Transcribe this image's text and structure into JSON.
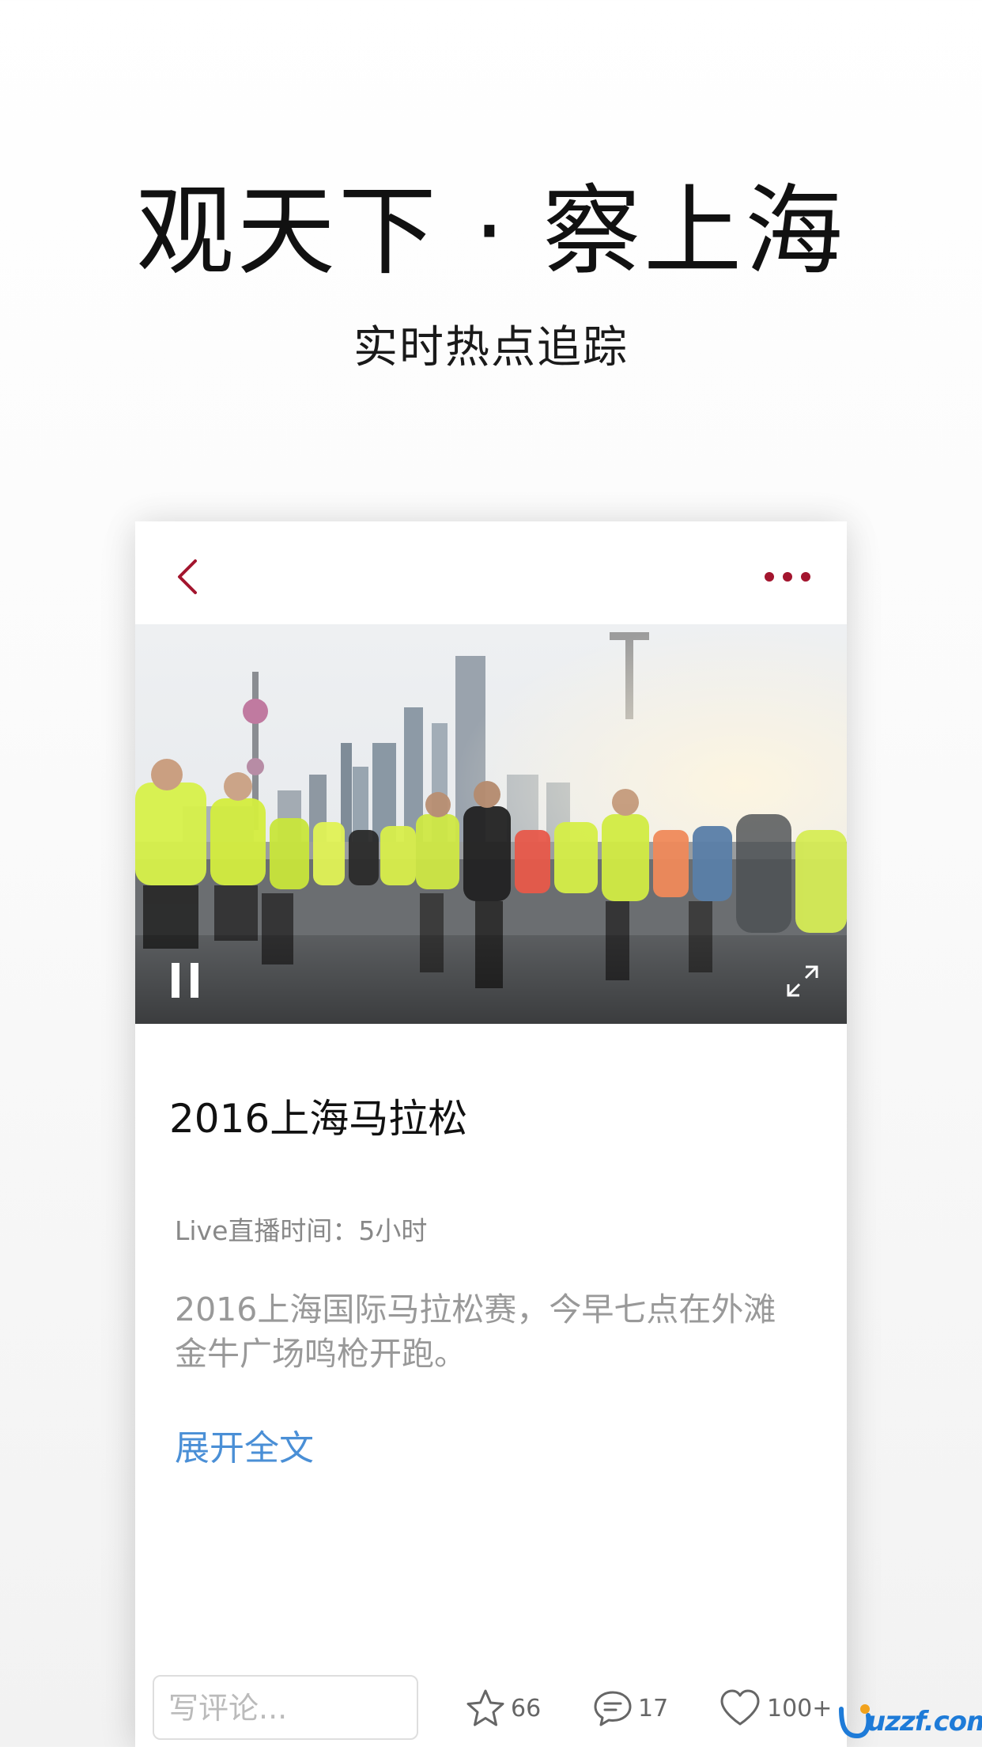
{
  "hero": {
    "title": "观天下 · 察上海",
    "subtitle": "实时热点追踪"
  },
  "nav": {
    "back_icon": "chevron-left-icon",
    "more_icon": "more-dots-icon",
    "accent_color": "#a3152e"
  },
  "video": {
    "state": "playing",
    "pause_icon": "pause-icon",
    "fullscreen_icon": "fullscreen-icon"
  },
  "article": {
    "title": "2016上海马拉松",
    "live_meta": "Live直播时间：5小时",
    "summary": "2016上海国际马拉松赛，今早七点在外滩金牛广场鸣枪开跑。",
    "expand_label": "展开全文",
    "link_color": "#4a8fd6"
  },
  "bottom_bar": {
    "comment_placeholder": "写评论...",
    "star_count": "66",
    "comment_count": "17",
    "like_count": "100+"
  },
  "watermark": {
    "text": "uzzf.com"
  }
}
